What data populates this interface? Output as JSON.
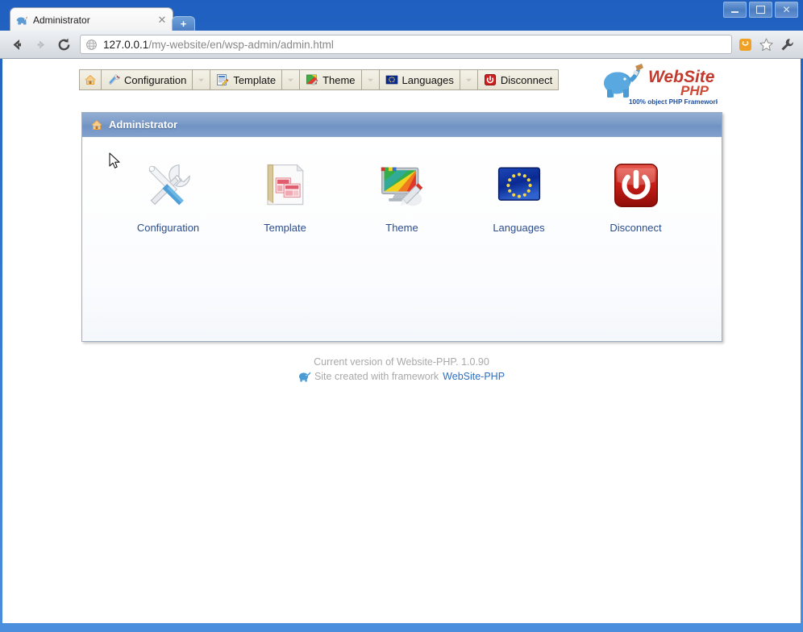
{
  "window": {
    "controls": {
      "minimize": "minimize-button",
      "maximize": "maximize-button",
      "close": "close-button",
      "close_glyph": "✕"
    }
  },
  "browser": {
    "tab": {
      "title": "Administrator",
      "close_glyph": "✕",
      "favicon": "elephant-favicon"
    },
    "new_tab_glyph": "+",
    "nav": {
      "back_glyph": "←",
      "forward_glyph": "→",
      "reload_glyph": "C",
      "url_host": "127.0.0.1",
      "url_path": "/my-website/en/wsp-admin/admin.html",
      "site_icon": "globe-icon",
      "extension_icon": "orange-badge-icon",
      "bookmark_icon": "star-icon",
      "menu_icon": "wrench-icon"
    }
  },
  "page": {
    "toolbar": {
      "home": {
        "label": "",
        "icon": "home-icon"
      },
      "items": [
        {
          "label": "Configuration",
          "icon": "tools-icon",
          "has_caret": true
        },
        {
          "label": "Template",
          "icon": "template-icon",
          "has_caret": true
        },
        {
          "label": "Theme",
          "icon": "theme-icon",
          "has_caret": true
        },
        {
          "label": "Languages",
          "icon": "flag-eu-icon",
          "has_caret": false
        },
        {
          "label": "Disconnect",
          "icon": "power-icon",
          "has_caret": false
        }
      ]
    },
    "logo": {
      "word1": "WebSite",
      "word2": "PHP",
      "tagline": "100% object PHP Framework"
    },
    "panel": {
      "title": "Administrator",
      "title_icon": "home-icon",
      "tiles": [
        {
          "label": "Configuration",
          "icon": "tools-icon"
        },
        {
          "label": "Template",
          "icon": "template-icon"
        },
        {
          "label": "Theme",
          "icon": "theme-icon"
        },
        {
          "label": "Languages",
          "icon": "flag-eu-icon"
        },
        {
          "label": "Disconnect",
          "icon": "power-icon"
        }
      ]
    },
    "footer": {
      "version_line": "Current version of Website-PHP. 1.0.90",
      "created_prefix": "Site created with framework",
      "framework_link": "WebSite-PHP",
      "elephant_icon": "elephant-icon"
    }
  },
  "colors": {
    "title_bar": "#2f74cf",
    "panel_header": "#7b9bc8",
    "link": "#2f6fbf",
    "tile_label": "#2b4c8c",
    "footer_text": "#a9a9a9",
    "toolbar_bg": "#ece9d8"
  }
}
